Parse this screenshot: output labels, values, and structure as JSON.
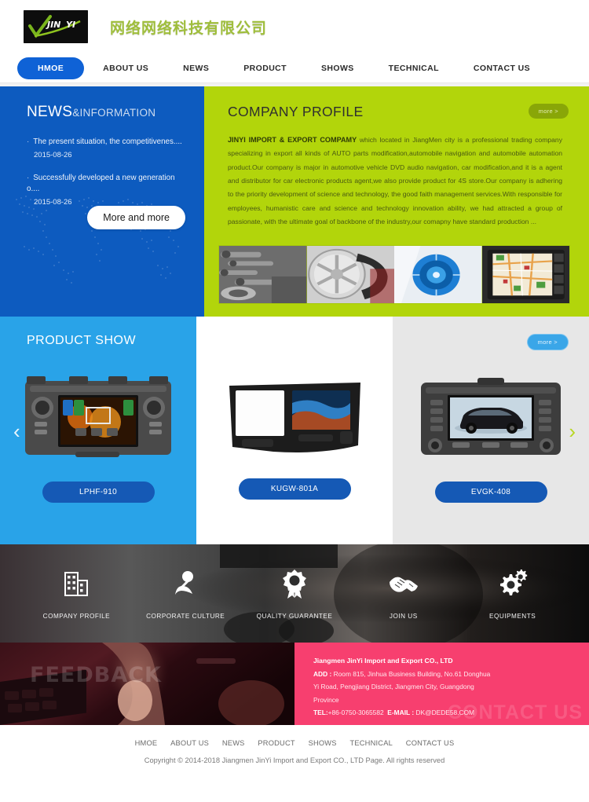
{
  "header": {
    "logo_mark_text": "JIN YI",
    "company_name_cn": "网络网络科技有限公司"
  },
  "nav": {
    "items": [
      {
        "label": "HMOE",
        "active": true
      },
      {
        "label": "ABOUT US",
        "active": false
      },
      {
        "label": "NEWS",
        "active": false
      },
      {
        "label": "PRODUCT",
        "active": false
      },
      {
        "label": "SHOWS",
        "active": false
      },
      {
        "label": "TECHNICAL",
        "active": false
      },
      {
        "label": "CONTACT US",
        "active": false
      }
    ]
  },
  "news": {
    "title_main": "NEWS",
    "title_sub": "&INFORMATION",
    "items": [
      {
        "title": "The present situation, the competitivenes....",
        "date": "2015-08-26"
      },
      {
        "title": "Successfully developed a new generation o....",
        "date": "2015-08-26"
      }
    ],
    "more_label": "More and more"
  },
  "profile": {
    "title": "COMPANY PROFILE",
    "more_label": "more >",
    "lead": "JINYI IMPORT & EXPORT COMPAMY",
    "body": " which located in JiangMen city is a professional trading company specializing in export all kinds of AUTO parts modification,automobile navigation and automobile automation product.Our company is major in automotive vehicle DVD audio navigation, car modification,and it is a agent and distributor for car electronic products agent,we also provide product for 4S store.Our company is adhering to the priority development of science and technology, the good faith management services.With responsible for employees, humanistic care and science and technology innovation ability, we had attracted a group of passionate, with the ultimate goal of backbone of the industry,our comapny have standard production ..."
  },
  "product_show": {
    "title": "PRODUCT SHOW",
    "more_label": "more >",
    "prev_icon": "chevron-left-icon",
    "next_icon": "chevron-right-icon",
    "items": [
      {
        "model": "LPHF-910",
        "image_alt": "car-dvd-navigation-unit"
      },
      {
        "model": "KUGW-801A",
        "image_alt": "car-dash-fascia-panel"
      },
      {
        "model": "EVGK-408",
        "image_alt": "car-dvd-screen-with-sedan"
      }
    ]
  },
  "services": {
    "items": [
      {
        "label": "COMPANY PROFILE",
        "icon": "building-icon"
      },
      {
        "label": "CORPORATE CULTURE",
        "icon": "microphone-icon"
      },
      {
        "label": "QUALITY GUARANTEE",
        "icon": "award-ribbon-icon"
      },
      {
        "label": "JOIN US",
        "icon": "handshake-icon"
      },
      {
        "label": "EQUIPMENTS",
        "icon": "gears-icon"
      }
    ]
  },
  "feedback": {
    "word": "FEEDBACK"
  },
  "contact": {
    "ghost_word": "CONTACT US",
    "company": "Jiangmen JinYi Import and Export CO., LTD",
    "add_label": "ADD :",
    "add_line1": " Room 815, Jinhua Business Building, No.61 Donghua",
    "add_line2": "Yi Road, Pengjiang District, Jiangmen City, Guangdong",
    "add_line3": "Province",
    "tel_label": "TEL:",
    "tel_value": "+86-0750-3065582",
    "email_label": "E-MAIL :",
    "email_value": " DK@DEDE58.COM"
  },
  "footer": {
    "nav": [
      "HMOE",
      "ABOUT US",
      "NEWS",
      "PRODUCT",
      "SHOWS",
      "TECHNICAL",
      "CONTACT US"
    ],
    "copyright": "Copyright © 2014-2018 Jiangmen JinYi Import and Export CO., LTD   Page. All rights reserved"
  },
  "colors": {
    "brand_blue": "#0f62d6",
    "news_blue": "#0d5bbf",
    "accent_green": "#b2d50b",
    "product_blue": "#29a3e8",
    "contact_pink": "#f73f6f",
    "button_blue": "#1559b5"
  }
}
